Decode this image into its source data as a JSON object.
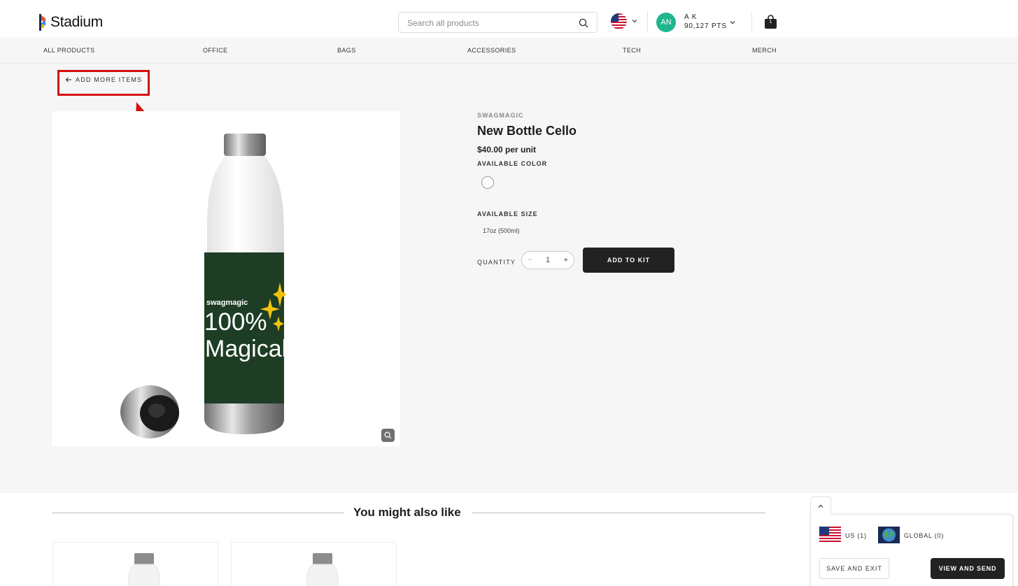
{
  "header": {
    "logo_text": "Stadium",
    "search_placeholder": "Search all products",
    "user_initials": "AN",
    "user_name": "A K",
    "user_points": "90,127 PTS",
    "cart_count": "1"
  },
  "nav": {
    "items": [
      "ALL PRODUCTS",
      "OFFICE",
      "BAGS",
      "ACCESSORIES",
      "TECH",
      "MERCH"
    ]
  },
  "back_link": "ADD MORE ITEMS",
  "product": {
    "image_text_brand": "swagmagic",
    "image_text_line1": "100%",
    "image_text_line2": "Magical",
    "brand": "SWAGMAGIC",
    "name": "New Bottle Cello",
    "price": "$40.00 per unit",
    "color_label": "AVAILABLE COLOR",
    "size_label": "AVAILABLE SIZE",
    "size_option": "17oz (500ml)",
    "quantity_label": "QUANTITY",
    "quantity_minus": "−",
    "quantity_value": "1",
    "quantity_plus": "+",
    "add_button": "ADD TO KIT"
  },
  "recommendations": {
    "title": "You might also like"
  },
  "kit_panel": {
    "us_label": "US (1)",
    "global_label": "GLOBAL (0)",
    "save_button": "SAVE AND EXIT",
    "send_button": "VIEW AND SEND"
  },
  "colors": {
    "accent": "#222222",
    "avatar": "#1fb58f",
    "annotation": "#d40f0f",
    "bottle_sleeve": "#1e3d25"
  }
}
